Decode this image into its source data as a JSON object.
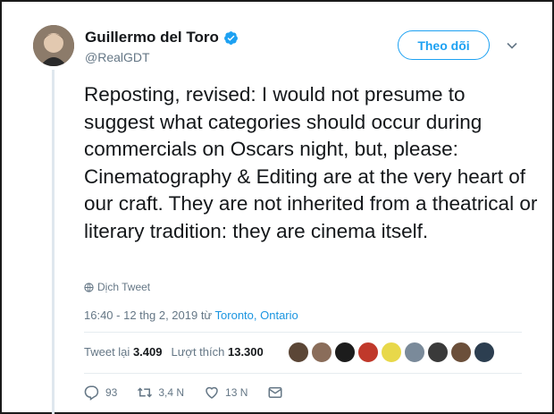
{
  "user": {
    "name": "Guillermo del Toro",
    "handle": "@RealGDT",
    "follow_label": "Theo dõi"
  },
  "tweet": {
    "text": "Reposting, revised: I would not presume to suggest what categories should occur during commercials on Oscars night, but, please: Cinematography & Editing are at the very heart of our craft. They are not inherited from a theatrical or literary tradition: they are cinema itself.",
    "translate_label": "Dịch Tweet",
    "time": "16:40 - 12 thg 2, 2019 từ ",
    "location": "Toronto, Ontario"
  },
  "stats": {
    "retweets_label": "Tweet lại",
    "retweets_count": "3.409",
    "likes_label": "Lượt thích",
    "likes_count": "13.300"
  },
  "likers": {
    "colors": [
      "#5b4636",
      "#8a6d5a",
      "#1c1c1c",
      "#c0392b",
      "#e8d84a",
      "#7a8a9a",
      "#3a3a3a",
      "#6b4f3a",
      "#2c3e50"
    ]
  },
  "actions": {
    "replies": "93",
    "retweets": "3,4 N",
    "likes": "13 N"
  },
  "colors": {
    "accent": "#1da1f2",
    "muted": "#657786",
    "link": "#1b95e0"
  }
}
